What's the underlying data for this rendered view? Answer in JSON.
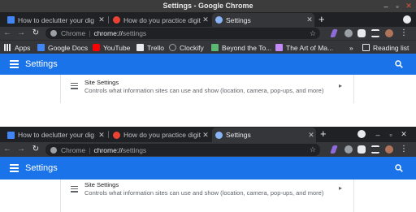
{
  "screens": [
    {
      "window_title": "Settings - Google Chrome",
      "tabs": [
        {
          "label": "How to declutter your dig",
          "favicon_color": "#4285f4",
          "active": false
        },
        {
          "label": "How do you practice digit",
          "favicon_color": "#ea4335",
          "active": false
        },
        {
          "label": "Settings",
          "favicon_color": "#8ab4f8",
          "active": true
        }
      ],
      "omnibox": {
        "scheme": "Chrome",
        "host": "chrome://",
        "path": "settings"
      },
      "bookmarks": [
        {
          "label": "Apps",
          "icon": "apps-grid-icon",
          "color": "#e8eaed"
        },
        {
          "label": "Google Docs",
          "icon": "docs-icon",
          "color": "#4285f4"
        },
        {
          "label": "YouTube",
          "icon": "youtube-icon",
          "color": "#ff0000"
        },
        {
          "label": "Trello",
          "icon": "trello-icon",
          "color": "#e8eaed"
        },
        {
          "label": "Clockify",
          "icon": "clockify-icon",
          "color": "#9aa0a6"
        },
        {
          "label": "Beyond the To...",
          "icon": "beyond-icon",
          "color": "#5bb974"
        },
        {
          "label": "The Art of Ma...",
          "icon": "art-icon",
          "color": "#c58af9"
        }
      ],
      "more_bookmarks": "»",
      "reading_list": "Reading list",
      "settings_title": "Settings",
      "site_settings": {
        "title": "Site Settings",
        "subtitle": "Controls what information sites can use and show (location, camera, pop-ups, and more)"
      }
    },
    {
      "tabs": [
        {
          "label": "How to declutter your dig",
          "favicon_color": "#4285f4",
          "active": false
        },
        {
          "label": "How do you practice digit",
          "favicon_color": "#ea4335",
          "active": false
        },
        {
          "label": "Settings",
          "favicon_color": "#8ab4f8",
          "active": true
        }
      ],
      "omnibox": {
        "scheme": "Chrome",
        "host": "chrome://",
        "path": "settings"
      },
      "settings_title": "Settings",
      "site_settings": {
        "title": "Site Settings",
        "subtitle": "Controls what information sites can use and show (location, camera, pop-ups, and more)"
      }
    }
  ],
  "colors": {
    "accent": "#1a73e8",
    "tab_active": "#35363a",
    "frame": "#202124"
  }
}
